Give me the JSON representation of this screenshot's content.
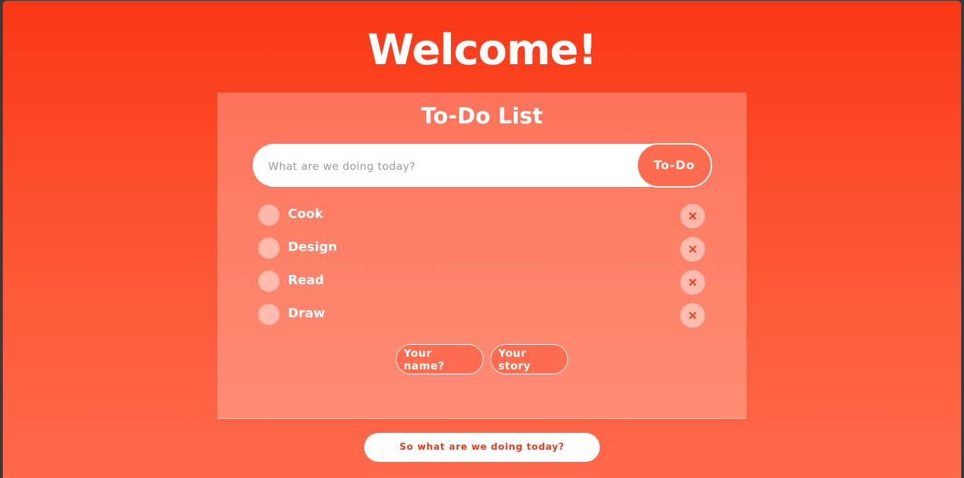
{
  "header": {
    "title": "Welcome!"
  },
  "card": {
    "title": "To-Do List",
    "input": {
      "placeholder": "What are we doing today?",
      "value": ""
    },
    "add_button_label": "To-Do",
    "items": [
      {
        "label": "Cook",
        "delete_glyph": "×"
      },
      {
        "label": "Design",
        "delete_glyph": "×"
      },
      {
        "label": "Read",
        "delete_glyph": "×"
      },
      {
        "label": "Draw",
        "delete_glyph": "×"
      }
    ],
    "links": {
      "name_label": "Your name?",
      "story_label": "Your story"
    }
  },
  "footer": {
    "cta_label": "So what are we doing today?"
  },
  "colors": {
    "background_top": "#fa3714",
    "background_bottom": "#ff6a4b",
    "accent": "#fd6c4e",
    "delete_icon": "#f03a1c"
  }
}
